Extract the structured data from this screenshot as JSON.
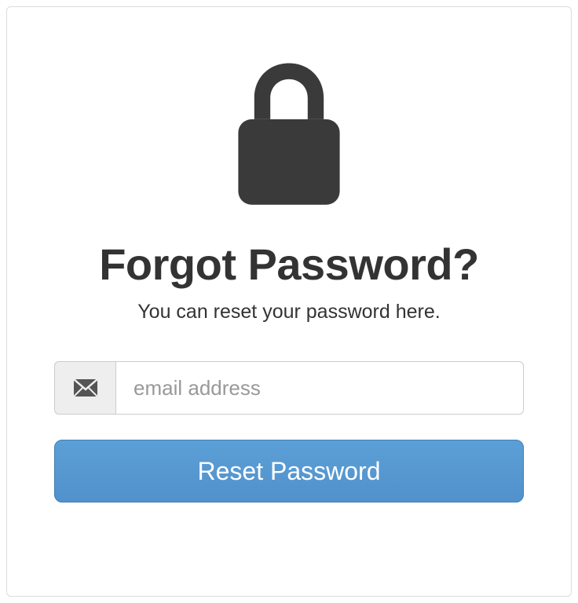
{
  "heading": "Forgot Password?",
  "subtitle": "You can reset your password here.",
  "email": {
    "placeholder": "email address",
    "value": ""
  },
  "submit_label": "Reset Password"
}
